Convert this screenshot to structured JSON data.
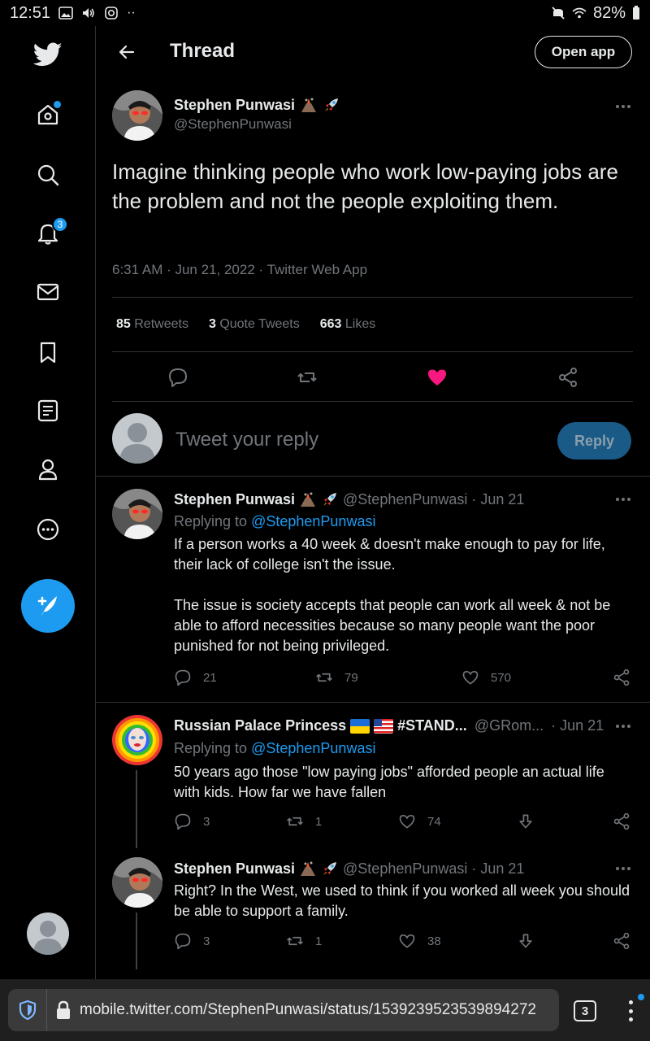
{
  "status_bar": {
    "time": "12:51",
    "battery": "82%",
    "dots": "··"
  },
  "header": {
    "title": "Thread",
    "open_app": "Open app"
  },
  "rail": {
    "notifications_badge": "3"
  },
  "main_tweet": {
    "name": "Stephen Punwasi",
    "handle": "@StephenPunwasi",
    "text": "Imagine thinking people who work low-paying jobs are the problem and not the people exploiting them.",
    "meta": "6:31 AM · Jun 21, 2022 · Twitter Web App",
    "retweets_count": "85",
    "retweets_label": "Retweets",
    "quotes_count": "3",
    "quotes_label": "Quote Tweets",
    "likes_count": "663",
    "likes_label": "Likes",
    "liked": true
  },
  "reply_box": {
    "placeholder": "Tweet your reply",
    "button": "Reply"
  },
  "replies": [
    {
      "name": "Stephen Punwasi",
      "handle": "@StephenPunwasi",
      "date": "· Jun 21",
      "replying_prefix": "Replying to",
      "replying_to": "@StephenPunwasi",
      "paragraph1": "If a person works a 40 week & doesn't make enough to pay for life, their lack of college isn't the issue.",
      "paragraph2": "The issue is society accepts that people can work all week & not be able to afford necessities because so many people want the poor punished for not being privileged.",
      "replies": "21",
      "retweets": "79",
      "likes": "570"
    },
    {
      "name": "Russian Palace Princess",
      "name_suffix": "#STAND...",
      "handle": "@GRom...",
      "date": "· Jun 21",
      "replying_prefix": "Replying to",
      "replying_to": "@StephenPunwasi",
      "text": "50 years ago those \"low paying jobs\" afforded people an actual life with kids.  How far we have fallen",
      "replies": "3",
      "retweets": "1",
      "likes": "74"
    },
    {
      "name": "Stephen Punwasi",
      "handle": "@StephenPunwasi",
      "date": "· Jun 21",
      "text": "Right? In the West, we used to think if you worked all week you should be able to support a family.",
      "replies": "3",
      "retweets": "1",
      "likes": "38"
    }
  ],
  "browser": {
    "url": "mobile.twitter.com/StephenPunwasi/status/1539239523539894272",
    "tabs_count": "3"
  },
  "colors": {
    "accent": "#1d9bf0",
    "like": "#f91880",
    "background": "#000000"
  }
}
